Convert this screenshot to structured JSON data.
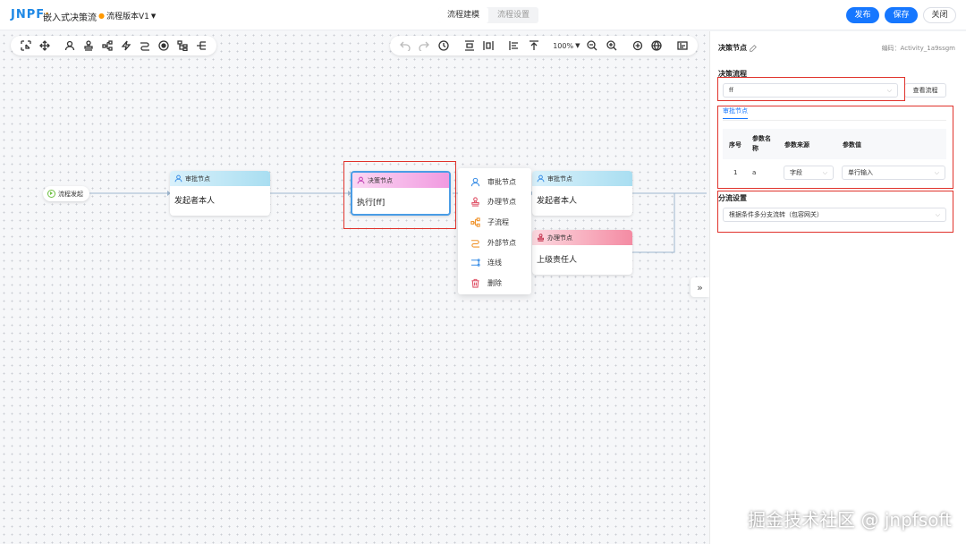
{
  "topbar": {
    "logo": "JNPF",
    "app_title": "嵌入式决策流",
    "version": "流程版本V1",
    "tabs": [
      {
        "label": "流程建模",
        "active": true
      },
      {
        "label": "流程设置",
        "active": false
      }
    ],
    "publish_label": "发布",
    "save_label": "保存",
    "close_label": "关闭"
  },
  "toolbar": {
    "zoom_level": "100%"
  },
  "canvas": {
    "start_label": "流程发起",
    "nodes": [
      {
        "type": "approval",
        "title": "审批节点",
        "content": "发起者本人"
      },
      {
        "type": "decision",
        "title": "决策节点",
        "content": "执行[ff]"
      },
      {
        "type": "approval",
        "title": "审批节点",
        "content": "发起者本人"
      },
      {
        "type": "handle",
        "title": "办理节点",
        "content": "上级责任人"
      }
    ],
    "context_menu": [
      {
        "label": "审批节点",
        "icon": "user-icon",
        "color": "#3a8ee6"
      },
      {
        "label": "办理节点",
        "icon": "stamp-icon",
        "color": "#e0566b"
      },
      {
        "label": "子流程",
        "icon": "subflow-icon",
        "color": "#f0932b"
      },
      {
        "label": "外部节点",
        "icon": "external-icon",
        "color": "#f0932b"
      },
      {
        "label": "连线",
        "icon": "connector-icon",
        "color": "#3a8ee6"
      },
      {
        "label": "删除",
        "icon": "trash-icon",
        "color": "#e0566b"
      }
    ]
  },
  "panel": {
    "title": "决策节点",
    "code": "编码：Activity_1a9ssgm",
    "decision_flow_label": "决策流程",
    "decision_flow_value": "ff",
    "view_flow_label": "查看流程",
    "subtab": "审批节点",
    "table": {
      "headers": [
        "序号",
        "参数名称",
        "参数来源",
        "参数值"
      ],
      "rows": [
        {
          "index": "1",
          "name": "a",
          "source": "字段",
          "value": "单行输入"
        }
      ]
    },
    "branch_label": "分流设置",
    "branch_value": "根据条件多分支流转（包容网关）"
  },
  "watermark": "掘金技术社区 @ jnpfsoft",
  "colors": {
    "primary": "#1677ff",
    "highlight_border": "#e0322b",
    "selected_border": "#4a9de6"
  }
}
